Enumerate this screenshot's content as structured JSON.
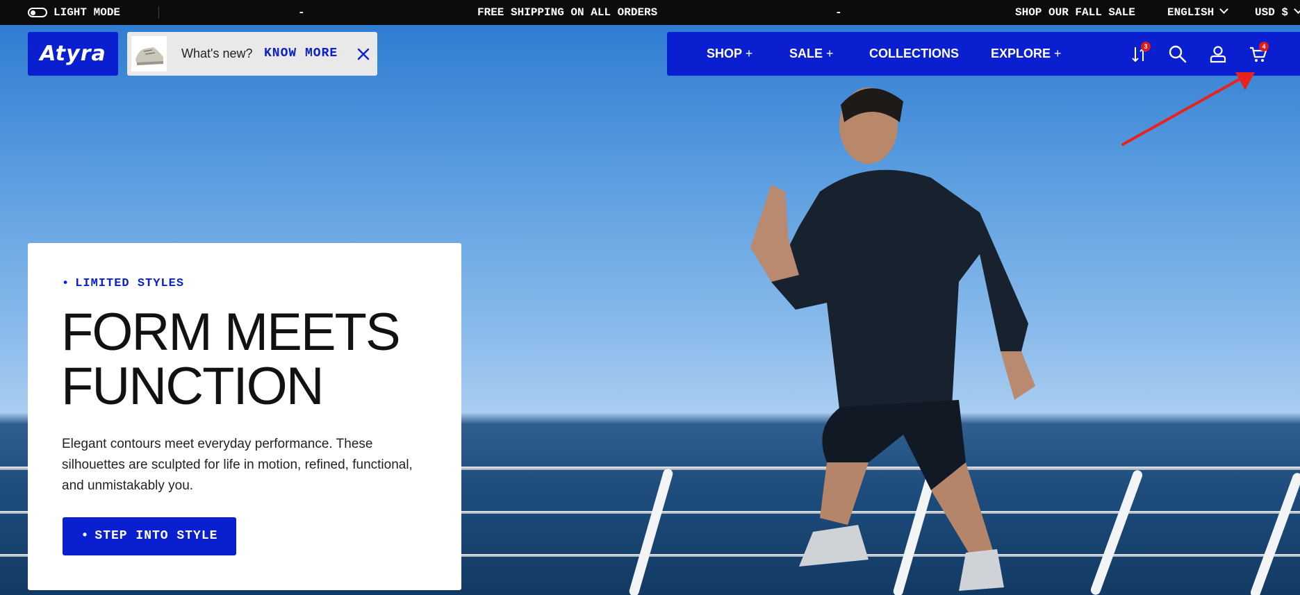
{
  "topbar": {
    "mode_label": "LIGHT MODE",
    "dash_left": "-",
    "announcement": "FREE SHIPPING ON ALL ORDERS",
    "dash_right": "-",
    "sale_link": "SHOP OUR FALL SALE",
    "language": "ENGLISH",
    "currency": "USD $"
  },
  "logo": {
    "text": "Atyra"
  },
  "news": {
    "label": "What's new?",
    "more": "KNOW MORE"
  },
  "nav": {
    "items": [
      {
        "label": "SHOP",
        "suffix": "+"
      },
      {
        "label": "SALE",
        "suffix": "+"
      },
      {
        "label": "COLLECTIONS",
        "suffix": ""
      },
      {
        "label": "EXPLORE",
        "suffix": "+"
      }
    ],
    "compare_count": "3",
    "cart_count": "4"
  },
  "hero": {
    "tag": "LIMITED STYLES",
    "title_line1": "FORM MEETS",
    "title_line2": "FUNCTION",
    "body": "Elegant contours meet everyday performance. These silhouettes are sculpted for life in motion, refined, functional, and unmistakably you.",
    "cta": "STEP INTO STYLE"
  },
  "colors": {
    "brand": "#0a1fcf",
    "badge": "#e01a1a",
    "arrow": "#e8221c"
  },
  "icons": [
    "toggle-icon",
    "chevron-down-icon",
    "close-icon",
    "compare-icon",
    "search-icon",
    "account-icon",
    "cart-icon"
  ]
}
